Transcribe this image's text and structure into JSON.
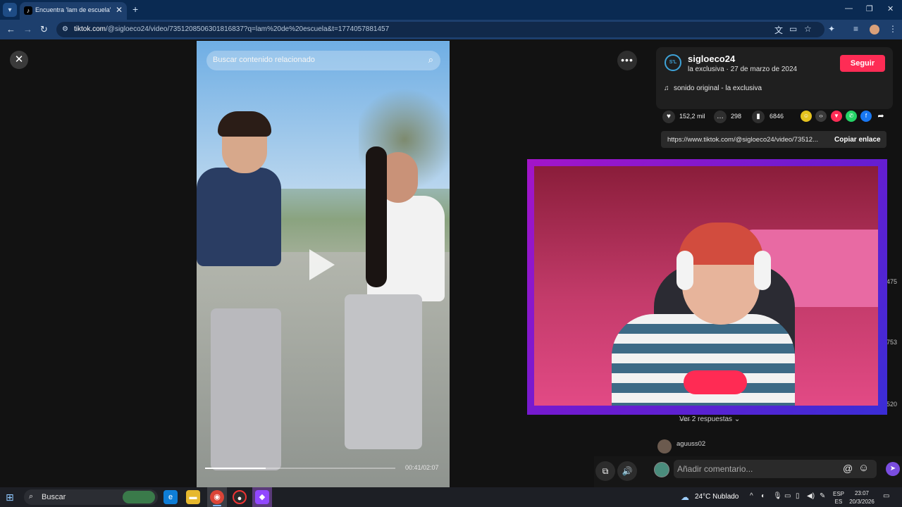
{
  "browser": {
    "tab_title": "Encuentra 'lam de escuela' en T",
    "url_host": "tiktok.com",
    "url_path": "/@sigloeco24/video/7351208506301816837?q=lam%20de%20escuela&t=1774057881457"
  },
  "video": {
    "search_placeholder": "Buscar contenido relacionado",
    "time": "00:41/02:07",
    "progress": 0.32
  },
  "author": {
    "avatar_text": "S'L",
    "name": "sigloeco24",
    "subtitle": "la exclusiva · 27 de marzo de 2024",
    "follow_label": "Seguir",
    "sound": "sonido original - la exclusiva"
  },
  "stats": {
    "likes": "152,2 mil",
    "comments": "298",
    "saves": "6846"
  },
  "share": {
    "link": "https://www.tiktok.com/@sigloeco24/video/73512...",
    "copy_label": "Copiar enlace"
  },
  "right_edge_numbers": [
    "475",
    "753",
    "520"
  ],
  "comments": {
    "see_replies": "Ver 2 respuestas",
    "first_user": "aguuss02",
    "input_placeholder": "Añadir comentario..."
  },
  "taskbar": {
    "search_text": "Buscar",
    "weather": "24°C  Nublado",
    "lang_top": "ESP",
    "lang_bottom": "ES",
    "time": "23:07",
    "date": "20/3/2026"
  },
  "colors": {
    "follow": "#fe2c55",
    "browser_chrome": "#1d3f6d",
    "webcam_border": "#a415c9"
  }
}
